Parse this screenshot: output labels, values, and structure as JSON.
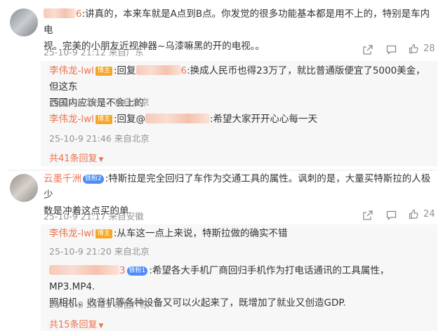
{
  "comments": [
    {
      "name_hidden": "",
      "name_suffix": "6",
      "text_line1": ":讲真的，本来车就是A点到B点。你发觉的很多功能基本都是用不上的，特别是车内电",
      "text_line2": "视。完美的小朋友近视神器~乌漆嘛黑的开的电视。。",
      "time": "25-10-9 21:12",
      "location": "来自广东",
      "likes": "28",
      "replies": [
        {
          "name": "李伟龙-lwl",
          "badge": "博主",
          "prefix": ":回复",
          "target_suffix": "6",
          "text_line1": ":换成人民币也得23万了，就比普通版便宜了5000美金，但这东",
          "text_line2": "西国内应该是不会上的",
          "time": "25-10-9 22:17",
          "location": "来自北京"
        },
        {
          "name": "李伟龙-lwl",
          "badge": "博主",
          "prefix": ":回复@",
          "target_suffix": "",
          "text_line1": ":希望大家开开心心每一天",
          "time": "25-10-9 21:46",
          "location": "来自北京"
        }
      ],
      "more_replies": "共41条回复"
    },
    {
      "name": "云墨千洲",
      "tag": "铁粉2",
      "text_line1": ":特斯拉是完全回归了车作为交通工具的属性。讽刺的是，大量买特斯拉的人极少",
      "text_line2": "数是冲着这点买的单",
      "time": "25-10-9 21:17",
      "location": "来自安徽",
      "likes": "24",
      "replies": [
        {
          "name": "李伟龙-lwl",
          "badge": "博主",
          "text_line1": ":从车这一点上来说，特斯拉做的确实不错",
          "time": "25-10-9 21:20",
          "location": "来自北京"
        },
        {
          "name_suffix": "3",
          "tag": "铁粉1",
          "text_line1": ":希望各大手机厂商回归手机作为打电话通讯的工具属性，MP3.MP4.",
          "text_line2": "照相机，收音机等各种设备又可以火起来了，既增加了就业又创造GDP.",
          "time": "25-10-9 23:23",
          "location": "来自广东"
        }
      ],
      "more_replies": "共15条回复"
    }
  ]
}
